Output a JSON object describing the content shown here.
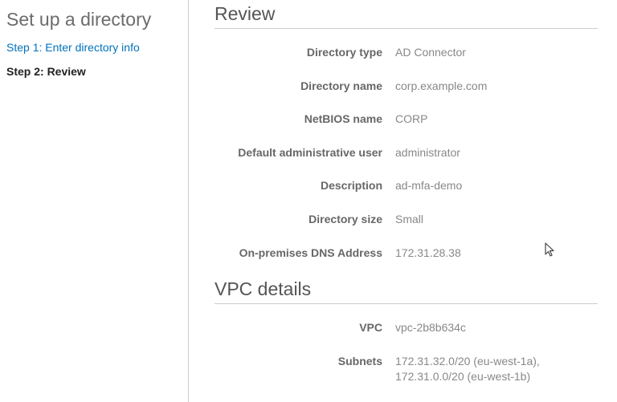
{
  "sidebar": {
    "title": "Set up a directory",
    "steps": [
      {
        "label": "Step 1: Enter directory info"
      },
      {
        "label": "Step 2: Review"
      }
    ]
  },
  "review": {
    "title": "Review",
    "rows": [
      {
        "label": "Directory type",
        "value": "AD Connector"
      },
      {
        "label": "Directory name",
        "value": "corp.example.com"
      },
      {
        "label": "NetBIOS name",
        "value": "CORP"
      },
      {
        "label": "Default administrative user",
        "value": "administrator"
      },
      {
        "label": "Description",
        "value": "ad-mfa-demo"
      },
      {
        "label": "Directory size",
        "value": "Small"
      },
      {
        "label": "On-premises DNS Address",
        "value": "172.31.28.38"
      }
    ]
  },
  "vpc": {
    "title": "VPC details",
    "rows": [
      {
        "label": "VPC",
        "value": "vpc-2b8b634c"
      },
      {
        "label": "Subnets",
        "value": "172.31.32.0/20 (eu-west-1a), 172.31.0.0/20 (eu-west-1b)"
      }
    ]
  }
}
